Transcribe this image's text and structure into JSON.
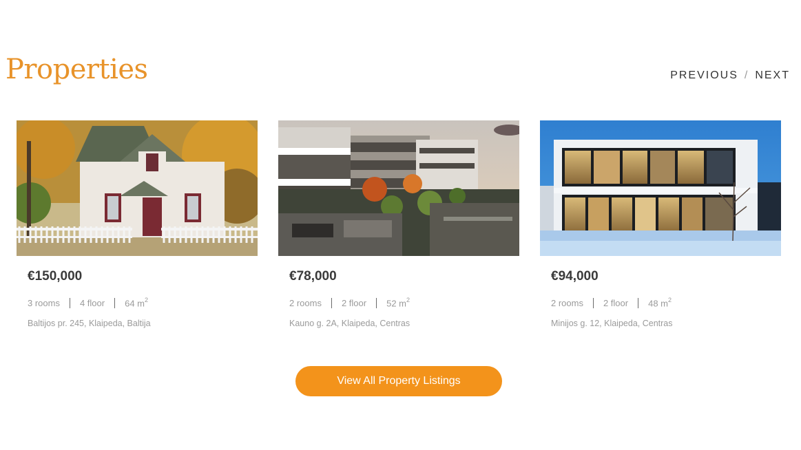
{
  "section": {
    "title": "Properties"
  },
  "pager": {
    "previous_label": "PREVIOUS",
    "separator": "/",
    "next_label": "NEXT"
  },
  "listings": [
    {
      "price": "€150,000",
      "rooms": "3 rooms",
      "floor": "4 floor",
      "area": "64 m",
      "area_unit_sup": "2",
      "address": "Baltijos pr. 245, Klaipeda, Baltija",
      "image": "white-house-autumn"
    },
    {
      "price": "€78,000",
      "rooms": "2 rooms",
      "floor": "2 floor",
      "area": "52 m",
      "area_unit_sup": "2",
      "address": "Kauno g. 2A, Klaipeda, Centras",
      "image": "apartment-complex-evening"
    },
    {
      "price": "€94,000",
      "rooms": "2 rooms",
      "floor": "2 floor",
      "area": "48 m",
      "area_unit_sup": "2",
      "address": "Minijos g. 12, Klaipeda, Centras",
      "image": "modern-glass-house-snow"
    }
  ],
  "cta": {
    "label": "View All Property Listings"
  },
  "colors": {
    "accent": "#e8932a",
    "button": "#f3931b",
    "text_dark": "#3a3a3a",
    "text_muted": "#9a9a9a"
  }
}
